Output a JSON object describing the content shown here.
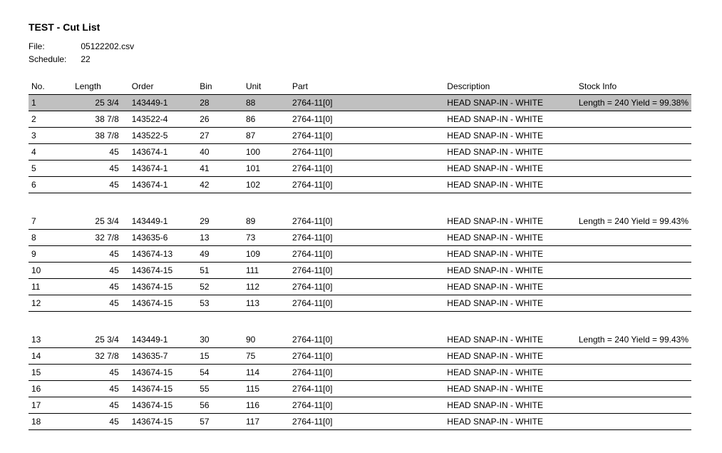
{
  "title": "TEST - Cut List",
  "meta": {
    "file_label": "File:",
    "file_value": "05122202.csv",
    "schedule_label": "Schedule:",
    "schedule_value": "22"
  },
  "columns": {
    "no": "No.",
    "length": "Length",
    "order": "Order",
    "bin": "Bin",
    "unit": "Unit",
    "part": "Part",
    "description": "Description",
    "stock_info": "Stock Info"
  },
  "groups": [
    {
      "rows": [
        {
          "no": "1",
          "length": "25  3/4",
          "order": "143449-1",
          "bin": "28",
          "unit": "88",
          "part": "2764-11[0]",
          "description": "HEAD SNAP-IN - WHITE",
          "stock_info": "Length = 240 Yield = 99.38%",
          "selected": true
        },
        {
          "no": "2",
          "length": "38  7/8",
          "order": "143522-4",
          "bin": "26",
          "unit": "86",
          "part": "2764-11[0]",
          "description": "HEAD SNAP-IN - WHITE",
          "stock_info": ""
        },
        {
          "no": "3",
          "length": "38  7/8",
          "order": "143522-5",
          "bin": "27",
          "unit": "87",
          "part": "2764-11[0]",
          "description": "HEAD SNAP-IN - WHITE",
          "stock_info": ""
        },
        {
          "no": "4",
          "length": "45",
          "order": "143674-1",
          "bin": "40",
          "unit": "100",
          "part": "2764-11[0]",
          "description": "HEAD SNAP-IN - WHITE",
          "stock_info": ""
        },
        {
          "no": "5",
          "length": "45",
          "order": "143674-1",
          "bin": "41",
          "unit": "101",
          "part": "2764-11[0]",
          "description": "HEAD SNAP-IN - WHITE",
          "stock_info": ""
        },
        {
          "no": "6",
          "length": "45",
          "order": "143674-1",
          "bin": "42",
          "unit": "102",
          "part": "2764-11[0]",
          "description": "HEAD SNAP-IN - WHITE",
          "stock_info": ""
        }
      ]
    },
    {
      "rows": [
        {
          "no": "7",
          "length": "25  3/4",
          "order": "143449-1",
          "bin": "29",
          "unit": "89",
          "part": "2764-11[0]",
          "description": "HEAD SNAP-IN - WHITE",
          "stock_info": "Length = 240 Yield = 99.43%"
        },
        {
          "no": "8",
          "length": "32  7/8",
          "order": "143635-6",
          "bin": "13",
          "unit": "73",
          "part": "2764-11[0]",
          "description": "HEAD SNAP-IN - WHITE",
          "stock_info": ""
        },
        {
          "no": "9",
          "length": "45",
          "order": "143674-13",
          "bin": "49",
          "unit": "109",
          "part": "2764-11[0]",
          "description": "HEAD SNAP-IN - WHITE",
          "stock_info": ""
        },
        {
          "no": "10",
          "length": "45",
          "order": "143674-15",
          "bin": "51",
          "unit": "111",
          "part": "2764-11[0]",
          "description": "HEAD SNAP-IN - WHITE",
          "stock_info": ""
        },
        {
          "no": "11",
          "length": "45",
          "order": "143674-15",
          "bin": "52",
          "unit": "112",
          "part": "2764-11[0]",
          "description": "HEAD SNAP-IN - WHITE",
          "stock_info": ""
        },
        {
          "no": "12",
          "length": "45",
          "order": "143674-15",
          "bin": "53",
          "unit": "113",
          "part": "2764-11[0]",
          "description": "HEAD SNAP-IN - WHITE",
          "stock_info": ""
        }
      ]
    },
    {
      "rows": [
        {
          "no": "13",
          "length": "25  3/4",
          "order": "143449-1",
          "bin": "30",
          "unit": "90",
          "part": "2764-11[0]",
          "description": "HEAD SNAP-IN - WHITE",
          "stock_info": "Length = 240 Yield = 99.43%"
        },
        {
          "no": "14",
          "length": "32  7/8",
          "order": "143635-7",
          "bin": "15",
          "unit": "75",
          "part": "2764-11[0]",
          "description": "HEAD SNAP-IN - WHITE",
          "stock_info": ""
        },
        {
          "no": "15",
          "length": "45",
          "order": "143674-15",
          "bin": "54",
          "unit": "114",
          "part": "2764-11[0]",
          "description": "HEAD SNAP-IN - WHITE",
          "stock_info": ""
        },
        {
          "no": "16",
          "length": "45",
          "order": "143674-15",
          "bin": "55",
          "unit": "115",
          "part": "2764-11[0]",
          "description": "HEAD SNAP-IN - WHITE",
          "stock_info": ""
        },
        {
          "no": "17",
          "length": "45",
          "order": "143674-15",
          "bin": "56",
          "unit": "116",
          "part": "2764-11[0]",
          "description": "HEAD SNAP-IN - WHITE",
          "stock_info": ""
        },
        {
          "no": "18",
          "length": "45",
          "order": "143674-15",
          "bin": "57",
          "unit": "117",
          "part": "2764-11[0]",
          "description": "HEAD SNAP-IN - WHITE",
          "stock_info": ""
        }
      ]
    }
  ]
}
